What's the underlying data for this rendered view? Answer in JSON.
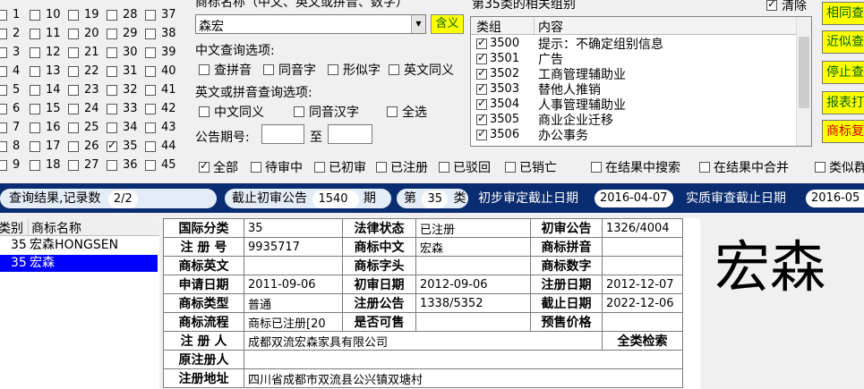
{
  "class_grid": {
    "rows": [
      [
        {
          "n": "1",
          "c": false
        },
        {
          "n": "10",
          "c": false
        },
        {
          "n": "19",
          "c": false
        },
        {
          "n": "28",
          "c": false
        },
        {
          "n": "37",
          "c": false
        }
      ],
      [
        {
          "n": "2",
          "c": false
        },
        {
          "n": "11",
          "c": false
        },
        {
          "n": "20",
          "c": false
        },
        {
          "n": "29",
          "c": false
        },
        {
          "n": "38",
          "c": false
        }
      ],
      [
        {
          "n": "3",
          "c": false
        },
        {
          "n": "12",
          "c": false
        },
        {
          "n": "21",
          "c": false
        },
        {
          "n": "30",
          "c": false
        },
        {
          "n": "39",
          "c": false
        }
      ],
      [
        {
          "n": "4",
          "c": false
        },
        {
          "n": "13",
          "c": false
        },
        {
          "n": "22",
          "c": false
        },
        {
          "n": "31",
          "c": false
        },
        {
          "n": "40",
          "c": false
        }
      ],
      [
        {
          "n": "5",
          "c": false
        },
        {
          "n": "14",
          "c": false
        },
        {
          "n": "23",
          "c": false
        },
        {
          "n": "32",
          "c": false
        },
        {
          "n": "41",
          "c": false
        }
      ],
      [
        {
          "n": "6",
          "c": false
        },
        {
          "n": "15",
          "c": false
        },
        {
          "n": "24",
          "c": false
        },
        {
          "n": "33",
          "c": false
        },
        {
          "n": "42",
          "c": false
        }
      ],
      [
        {
          "n": "7",
          "c": false
        },
        {
          "n": "16",
          "c": false
        },
        {
          "n": "25",
          "c": false
        },
        {
          "n": "34",
          "c": false
        },
        {
          "n": "43",
          "c": false
        }
      ],
      [
        {
          "n": "8",
          "c": false
        },
        {
          "n": "17",
          "c": false
        },
        {
          "n": "26",
          "c": false
        },
        {
          "n": "35",
          "c": true
        },
        {
          "n": "44",
          "c": false
        }
      ],
      [
        {
          "n": "9",
          "c": false
        },
        {
          "n": "18",
          "c": false
        },
        {
          "n": "27",
          "c": false
        },
        {
          "n": "36",
          "c": false
        },
        {
          "n": "45",
          "c": false
        }
      ]
    ]
  },
  "query": {
    "name_label": "商标名称（中文、英文或拼音、数字）",
    "name_value": "森宏",
    "contains_button": "含义",
    "cn_options_label": "中文查询选项:",
    "cn_options": [
      {
        "label": "查拼音",
        "checked": false
      },
      {
        "label": "同音字",
        "checked": false
      },
      {
        "label": "形似字",
        "checked": false
      },
      {
        "label": "英文同义",
        "checked": false
      }
    ],
    "en_options_label": "英文或拼音查询选项:",
    "en_options": [
      {
        "label": "中文同义",
        "checked": false
      },
      {
        "label": "同音汉字",
        "checked": false
      },
      {
        "label": "全选",
        "checked": false
      }
    ],
    "period_label": "公告期号:",
    "period_to": "至",
    "period_from_value": "",
    "period_to_value": ""
  },
  "groups": {
    "title": "第35类的相关组别",
    "clear_label": "清除",
    "clear_checked": true,
    "col_group": "类组",
    "col_content": "内容",
    "rows": [
      {
        "code": "3500",
        "text": "提示：不确定组别信息",
        "checked": true
      },
      {
        "code": "3501",
        "text": "广告",
        "checked": true
      },
      {
        "code": "3502",
        "text": "工商管理辅助业",
        "checked": true
      },
      {
        "code": "3503",
        "text": "替他人推销",
        "checked": true
      },
      {
        "code": "3504",
        "text": "人事管理辅助业",
        "checked": true
      },
      {
        "code": "3505",
        "text": "商业企业迁移",
        "checked": true
      },
      {
        "code": "3506",
        "text": "办公事务",
        "checked": true
      }
    ]
  },
  "actions": {
    "same_button": "相同查",
    "similar_button": "近似查",
    "stop_button": "停止查",
    "report_button": "报表打",
    "trademark_button": "商标复"
  },
  "filters": [
    {
      "label": "全部",
      "checked": true
    },
    {
      "label": "待审中",
      "checked": false
    },
    {
      "label": "已初审",
      "checked": false
    },
    {
      "label": "已注册",
      "checked": false
    },
    {
      "label": "已驳回",
      "checked": false
    },
    {
      "label": "已销亡",
      "checked": false
    },
    {
      "label": "在结果中搜索",
      "checked": false
    },
    {
      "label": "在结果中合并",
      "checked": false
    },
    {
      "label": "类似群",
      "checked": false
    }
  ],
  "status": {
    "result_label": "查询结果,记录数",
    "result_count": "2/2",
    "cutoff_label": "截止初审公告",
    "cutoff_value": "1540",
    "cutoff_unit": "期",
    "class_prefix": "第",
    "class_value": "35",
    "class_suffix": "类",
    "prelim_label": "初步审定截止日期",
    "prelim_date": "2016-04-07",
    "exam_label": "实质审查截止日期",
    "exam_date": "2016-05"
  },
  "result_list": {
    "col_class": "类别",
    "col_name": "商标名称",
    "rows": [
      {
        "cls": "35",
        "name": "宏森HONGSEN",
        "selected": false
      },
      {
        "cls": "35",
        "name": "宏森",
        "selected": true
      }
    ]
  },
  "detail": {
    "intl_class_label": "国际分类",
    "intl_class": "35",
    "legal_status_label": "法律状态",
    "legal_status": "已注册",
    "prelim_label": "初审公告",
    "prelim": "1326/4004",
    "reg_no_label": "注 册 号",
    "reg_no": "9935717",
    "cn_name_label": "商标中文",
    "cn_name": "宏森",
    "pinyin_label": "商标拼音",
    "pinyin": "",
    "en_label": "商标英文",
    "en": "",
    "head_label": "商标字头",
    "head": "",
    "digit_label": "商标数字",
    "digit": "",
    "apply_date_label": "申请日期",
    "apply_date": "2011-09-06",
    "prelim_date_label": "初审日期",
    "prelim_date": "2012-09-06",
    "reg_date_label": "注册日期",
    "reg_date": "2012-12-07",
    "type_label": "商标类型",
    "type": "普通",
    "reg_notice_label": "注册公告",
    "reg_notice": "1338/5352",
    "end_date_label": "截止日期",
    "end_date": "2022-12-06",
    "flow_label": "商标流程",
    "flow": "商标已注册[20",
    "for_sale_label": "是否可售",
    "for_sale": "",
    "presale_label": "预售价格",
    "presale": "",
    "registrant_label": "注 册 人",
    "registrant": "成都双流宏森家具有限公司",
    "all_class_search": "全类检索",
    "orig_registrant_label": "原注册人",
    "orig_registrant": "",
    "address_label": "注册地址",
    "address": "四川省成都市双流县公兴镇双塘村"
  },
  "preview": {
    "text": "宏森"
  }
}
